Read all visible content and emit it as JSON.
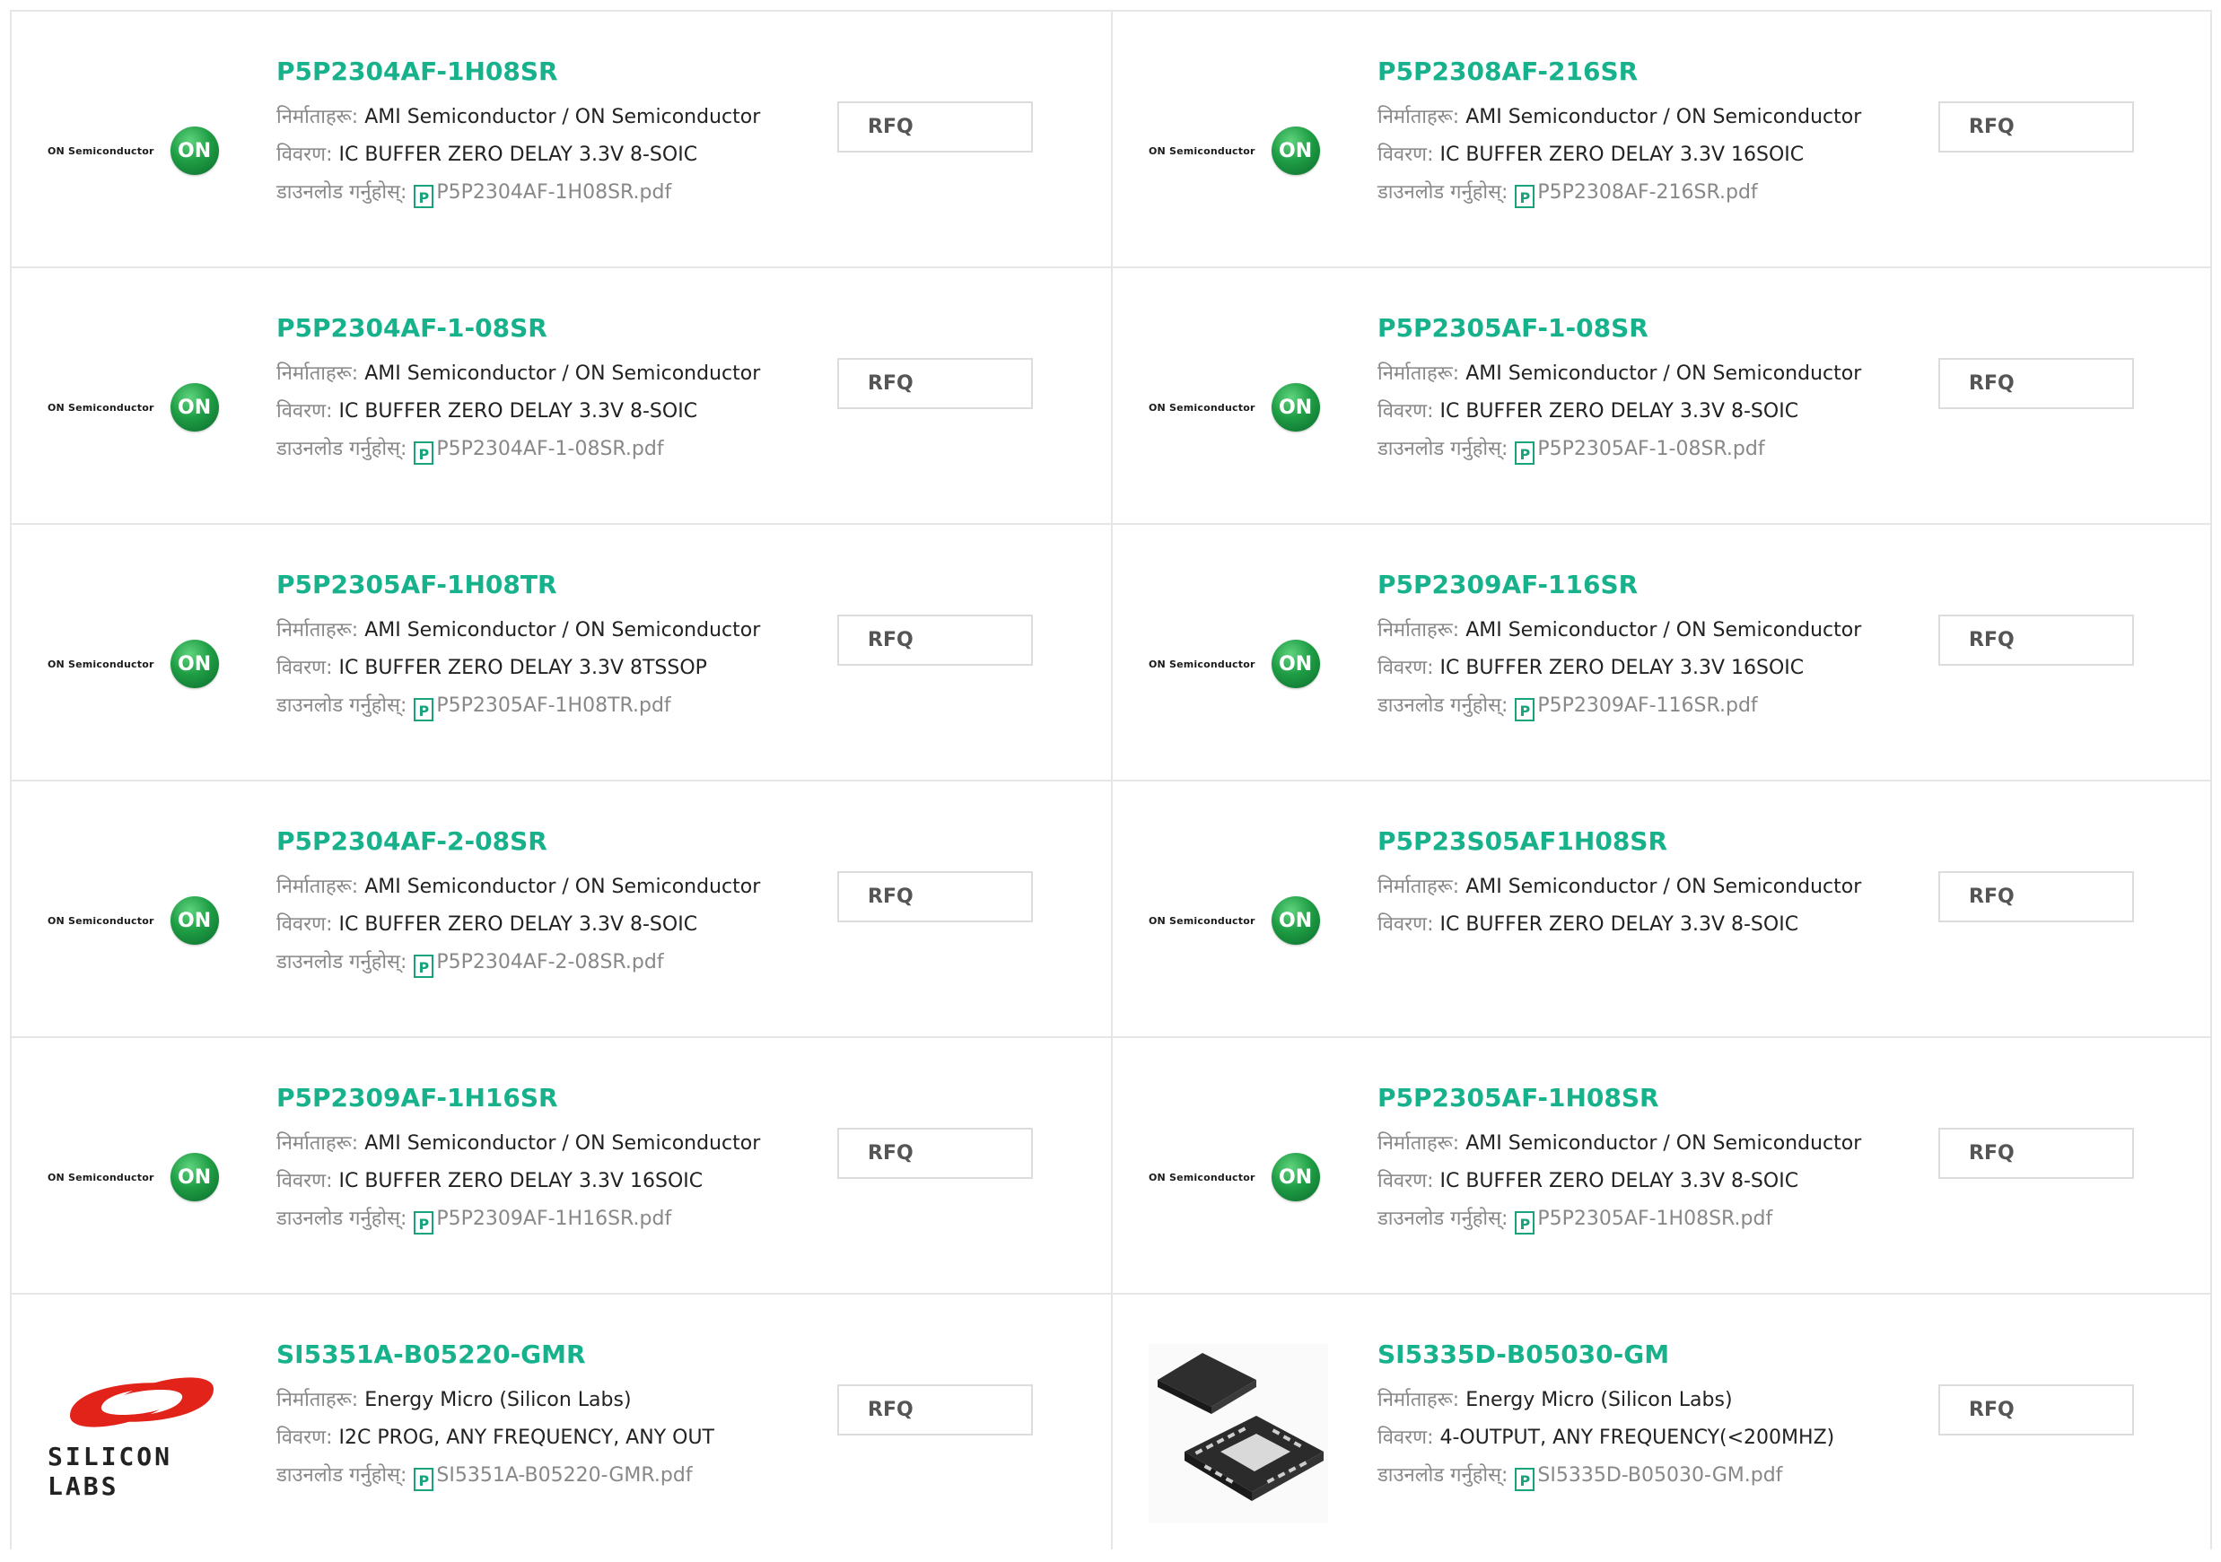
{
  "labels": {
    "manufacturer": "निर्माताहरू:",
    "description": "विवरण:",
    "download": "डाउनलोड गर्नुहोस्:",
    "rfq": "RFQ",
    "pdf_icon_glyph": "P"
  },
  "brand_logos": {
    "onsemi_text": "ON Semiconductor",
    "onsemi_mark": "ON",
    "silabs_text": "SILICON LABS"
  },
  "colors": {
    "part_link": "#17b28c",
    "on_green": "#1f9e45",
    "silabs_red": "#e2231a"
  },
  "products": [
    {
      "part": "P5P2304AF-1H08SR",
      "manufacturer": "AMI Semiconductor / ON Semiconductor",
      "description": "IC BUFFER ZERO DELAY 3.3V 8-SOIC",
      "pdf": "P5P2304AF-1H08SR.pdf",
      "logo": "onsemi"
    },
    {
      "part": "P5P2308AF-216SR",
      "manufacturer": "AMI Semiconductor / ON Semiconductor",
      "description": "IC BUFFER ZERO DELAY 3.3V 16SOIC",
      "pdf": "P5P2308AF-216SR.pdf",
      "logo": "onsemi"
    },
    {
      "part": "P5P2304AF-1-08SR",
      "manufacturer": "AMI Semiconductor / ON Semiconductor",
      "description": "IC BUFFER ZERO DELAY 3.3V 8-SOIC",
      "pdf": "P5P2304AF-1-08SR.pdf",
      "logo": "onsemi"
    },
    {
      "part": "P5P2305AF-1-08SR",
      "manufacturer": "AMI Semiconductor / ON Semiconductor",
      "description": "IC BUFFER ZERO DELAY 3.3V 8-SOIC",
      "pdf": "P5P2305AF-1-08SR.pdf",
      "logo": "onsemi"
    },
    {
      "part": "P5P2305AF-1H08TR",
      "manufacturer": "AMI Semiconductor / ON Semiconductor",
      "description": "IC BUFFER ZERO DELAY 3.3V 8TSSOP",
      "pdf": "P5P2305AF-1H08TR.pdf",
      "logo": "onsemi"
    },
    {
      "part": "P5P2309AF-116SR",
      "manufacturer": "AMI Semiconductor / ON Semiconductor",
      "description": "IC BUFFER ZERO DELAY 3.3V 16SOIC",
      "pdf": "P5P2309AF-116SR.pdf",
      "logo": "onsemi"
    },
    {
      "part": "P5P2304AF-2-08SR",
      "manufacturer": "AMI Semiconductor / ON Semiconductor",
      "description": "IC BUFFER ZERO DELAY 3.3V 8-SOIC",
      "pdf": "P5P2304AF-2-08SR.pdf",
      "logo": "onsemi"
    },
    {
      "part": "P5P23S05AF1H08SR",
      "manufacturer": "AMI Semiconductor / ON Semiconductor",
      "description": "IC BUFFER ZERO DELAY 3.3V 8-SOIC",
      "pdf": null,
      "logo": "onsemi"
    },
    {
      "part": "P5P2309AF-1H16SR",
      "manufacturer": "AMI Semiconductor / ON Semiconductor",
      "description": "IC BUFFER ZERO DELAY 3.3V 16SOIC",
      "pdf": "P5P2309AF-1H16SR.pdf",
      "logo": "onsemi"
    },
    {
      "part": "P5P2305AF-1H08SR",
      "manufacturer": "AMI Semiconductor / ON Semiconductor",
      "description": "IC BUFFER ZERO DELAY 3.3V 8-SOIC",
      "pdf": "P5P2305AF-1H08SR.pdf",
      "logo": "onsemi"
    },
    {
      "part": "SI5351A-B05220-GMR",
      "manufacturer": "Energy Micro (Silicon Labs)",
      "description": "I2C PROG, ANY FREQUENCY, ANY OUT",
      "pdf": "SI5351A-B05220-GMR.pdf",
      "logo": "silabs"
    },
    {
      "part": "SI5335D-B05030-GM",
      "manufacturer": "Energy Micro (Silicon Labs)",
      "description": "4-OUTPUT, ANY FREQUENCY(<200MHZ)",
      "pdf": "SI5335D-B05030-GM.pdf",
      "logo": "chip"
    }
  ]
}
